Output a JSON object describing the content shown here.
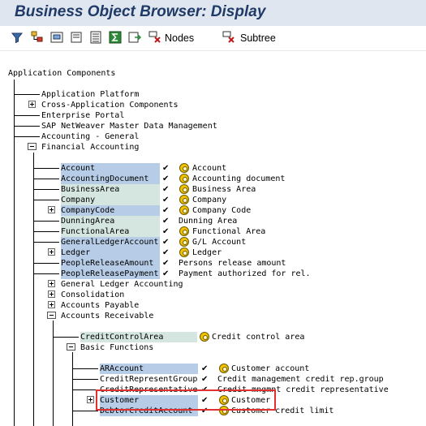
{
  "window": {
    "title": "Business Object Browser: Display"
  },
  "toolbar": {
    "icons": [
      "filter-icon",
      "hierarchy-icon",
      "structure-icon",
      "new-page-icon",
      "details-icon",
      "sum-icon",
      "export-icon",
      "nodes-icon",
      "subtree-icon"
    ],
    "nodes_label": "Nodes",
    "subtree_label": "Subtree"
  },
  "tree": {
    "root": "Application Components",
    "level1": [
      {
        "label": "Application Platform"
      },
      {
        "label": "Cross-Application Components"
      },
      {
        "label": "Enterprise Portal"
      },
      {
        "label": "SAP NetWeaver Master Data Management"
      },
      {
        "label": "Accounting - General"
      },
      {
        "label": "Financial Accounting"
      }
    ],
    "financial_objects": [
      {
        "name": "Account",
        "desc": "Account"
      },
      {
        "name": "AccountingDocument",
        "desc": "Accounting document"
      },
      {
        "name": "BusinessArea",
        "desc": "Business Area"
      },
      {
        "name": "Company",
        "desc": "Company"
      },
      {
        "name": "CompanyCode",
        "desc": "Company Code"
      },
      {
        "name": "DunningArea",
        "desc": "Dunning Area"
      },
      {
        "name": "FunctionalArea",
        "desc": "Functional Area"
      },
      {
        "name": "GeneralLedgerAccount",
        "desc": "G/L Account"
      },
      {
        "name": "Ledger",
        "desc": "Ledger"
      },
      {
        "name": "PeopleReleaseAmount",
        "desc": "Persons release amount"
      },
      {
        "name": "PeopleReleasePayment",
        "desc": "Payment authorized for rel."
      }
    ],
    "financial_sub": [
      {
        "label": "General Ledger Accounting"
      },
      {
        "label": "Consolidation"
      },
      {
        "label": "Accounts Payable"
      },
      {
        "label": "Accounts Receivable"
      }
    ],
    "ar_objects": [
      {
        "name": "CreditControlArea",
        "desc": "Credit control area"
      }
    ],
    "basic_functions": "Basic Functions",
    "bf_objects": [
      {
        "name": "ARAccount",
        "desc": "Customer account"
      },
      {
        "name": "CreditRepresentGroup",
        "desc": "Credit management credit rep.group"
      },
      {
        "name": "CreditRepresentative",
        "desc": "Credit mngmnt credit representative"
      },
      {
        "name": "Customer",
        "desc": "Customer"
      },
      {
        "name": "DebtorCreditAccount",
        "desc": "Customer credit limit"
      }
    ],
    "check_mark": "✔"
  }
}
